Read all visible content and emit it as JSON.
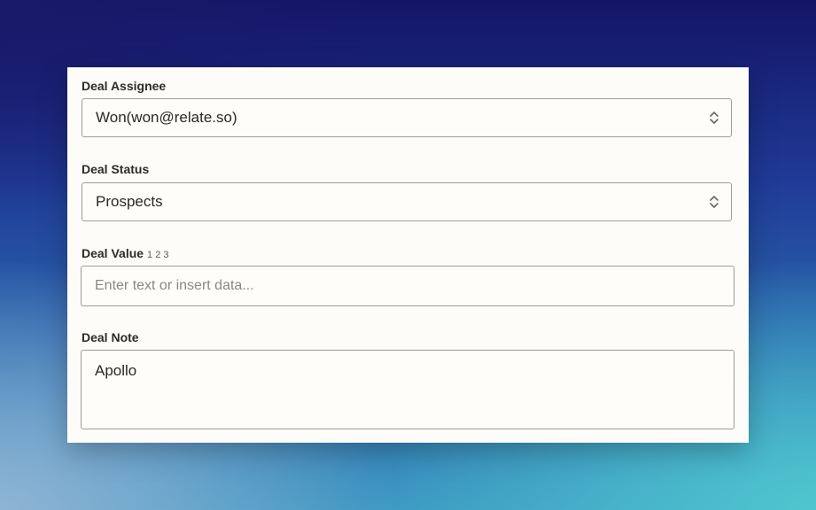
{
  "deal_assignee": {
    "label": "Deal Assignee",
    "value": "Won(won@relate.so)",
    "icon": "chevron-up-down-icon"
  },
  "deal_status": {
    "label": "Deal Status",
    "value": "Prospects",
    "icon": "chevron-up-down-icon"
  },
  "deal_value": {
    "label": "Deal Value",
    "hint": "1 2 3",
    "placeholder": "Enter text or insert data..."
  },
  "deal_note": {
    "label": "Deal Note",
    "value": "Apollo"
  },
  "colors": {
    "card_background": "#fdfcf8",
    "border": "#a09d96",
    "label_text": "#2e2b26",
    "placeholder_text": "#8b8882"
  }
}
